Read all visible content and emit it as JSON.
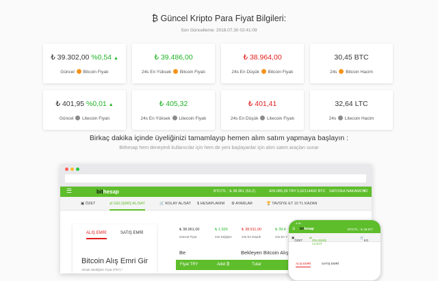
{
  "header": {
    "title": "₿ Güncel Kripto Para Fiyat Bilgileri:",
    "updated": "Son Güncelleme: 2018.07.30 02:41:09"
  },
  "cards": [
    {
      "value": "₺ 39.302,00",
      "change": "%0,54",
      "label_pre": "Güncel",
      "label_post": "Bitcoin Fiyatı",
      "coin": "btc"
    },
    {
      "value": "₺ 39.486,00",
      "label_pre": "24s En Yüksek",
      "label_post": "Bitcoin Fiyatı",
      "coin": "btc"
    },
    {
      "value": "₺ 38.964,00",
      "label_pre": "24s En Düşük",
      "label_post": "Bitcoin Fiyatı",
      "coin": "btc"
    },
    {
      "value": "30,45 BTC",
      "label_pre": "24s",
      "label_post": "Bitcoin Hacim",
      "coin": "btc"
    },
    {
      "value": "₺ 401,95",
      "change": "%0,01",
      "label_pre": "Güncel",
      "label_post": "Litecoin Fiyatı",
      "coin": "ltc"
    },
    {
      "value": "₺ 405,32",
      "label_pre": "24s En Yüksek",
      "label_post": "Litecoin Fiyatı",
      "coin": "ltc"
    },
    {
      "value": "₺ 401,41",
      "label_pre": "24s En Düşük",
      "label_post": "Litecoin Fiyatı",
      "coin": "ltc"
    },
    {
      "value": "32,64 LTC",
      "label_pre": "24s",
      "label_post": "Litecoin Hacim",
      "coin": "ltc"
    }
  ],
  "cta": {
    "title": "Birkaç dakika içinde üyeliğinizi tamamlayıp hemen alım satım yapmaya başlayın :",
    "subtitle": "Bithesap hem deneyimli kullanıcılar için hem de yeni başlayanlar için alım satım araçları sunar"
  },
  "mockup": {
    "logo_pre": "bit",
    "logo_post": "hesap",
    "balance_btc": "BTC/TL : ₺ 38.961 (55,2)",
    "balance_total": "429.085,39 TRY 0,62114402 BTC",
    "user": "SATOSHI NAKAMOTO",
    "nav": [
      "ÖZET",
      "GELİŞMİŞ AL/SAT",
      "KOLAY AL/SAT",
      "HESAPLARIM",
      "AYARLAR",
      "TAVSİYE ET 10 TL KAZAN"
    ],
    "tabs": [
      "ALIŞ EMRİ",
      "SATIŞ EMRİ"
    ],
    "order_title": "Bitcoin Alış Emri Gir",
    "order_sub": "Almak istediğiniz Fiyat (TRY) *",
    "stats": [
      {
        "value": "₺ 38.961,00",
        "label": "Güncel Fiyat"
      },
      {
        "value": "₺ 1.926",
        "label": "24s Değişim"
      },
      {
        "value": "₺ 38.911,00",
        "label": "24s En Düşük"
      },
      {
        "value": "₺ 39.4",
        "label": "24s En Y"
      }
    ],
    "section_pre": "Be",
    "section_main": "Bekleyen Bitcoin Alış Emirleri",
    "section_post": "Be",
    "table_headers": [
      "Fiyat TRY",
      "Adet ₿",
      "Tutar"
    ],
    "phone": {
      "time": "9:30",
      "balance": "BTC/TL : ₺ 38.877",
      "nav": [
        "ÖZET",
        "GELİŞMİŞ AL/SAT",
        "KO"
      ],
      "tabs": [
        "ALIŞ EMRİ",
        "SATIŞ EMRİ"
      ]
    }
  },
  "colors": {
    "green": "#1fb324",
    "red": "#e01b1b",
    "brand": "#5ebd2b",
    "bitcoin": "#f7931a"
  }
}
